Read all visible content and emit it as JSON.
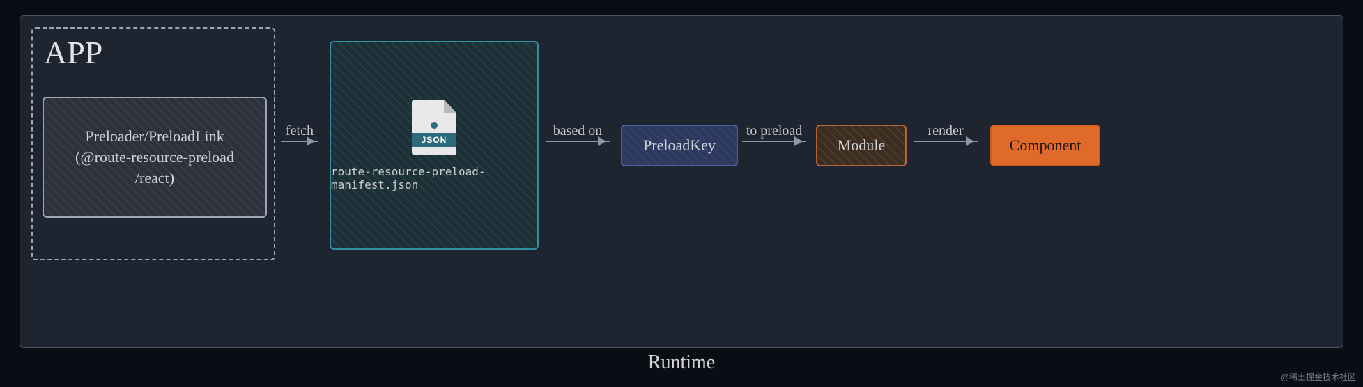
{
  "panel": {
    "title": "Runtime"
  },
  "app": {
    "title": "APP",
    "preloader_line1": "Preloader/PreloadLink",
    "preloader_line2": "(@route-resource-preload",
    "preloader_line3": "/react)"
  },
  "manifest": {
    "icon_label": "JSON",
    "filename": "route-resource-preload-manifest.json"
  },
  "nodes": {
    "preloadkey": "PreloadKey",
    "module": "Module",
    "component": "Component"
  },
  "arrows": {
    "a1": "fetch",
    "a2": "based on",
    "a3": "to preload",
    "a4": "render"
  },
  "watermark": "@稀土掘金技术社区"
}
